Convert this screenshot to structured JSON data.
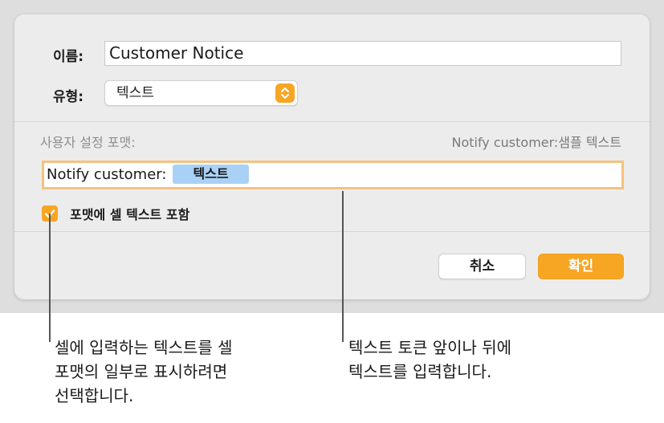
{
  "dialog": {
    "name_label": "이름:",
    "name_value": "Customer Notice",
    "type_label": "유형:",
    "type_value": "텍스트",
    "format_label": "사용자 설정 포맷:",
    "sample_text": "Notify customer:샘플 텍스트",
    "format_prefix": "Notify customer:",
    "format_token": "텍스트",
    "include_cell_text_label": "포맷에 셀 텍스트 포함",
    "include_cell_text_checked": true,
    "cancel_label": "취소",
    "ok_label": "확인"
  },
  "callouts": {
    "left_line1": "셀에 입력하는 텍스트를 셀",
    "left_line2": "포맷의 일부로 표시하려면",
    "left_line3": "선택합니다.",
    "right_line1": "텍스트 토큰 앞이나 뒤에",
    "right_line2": "텍스트를 입력합니다."
  },
  "colors": {
    "accent": "#f6a623",
    "token": "#a9d1f6",
    "focus_ring": "#f4c27f"
  },
  "icons": {
    "select": "updown-chevrons-icon",
    "checkbox": "checkmark-icon"
  }
}
